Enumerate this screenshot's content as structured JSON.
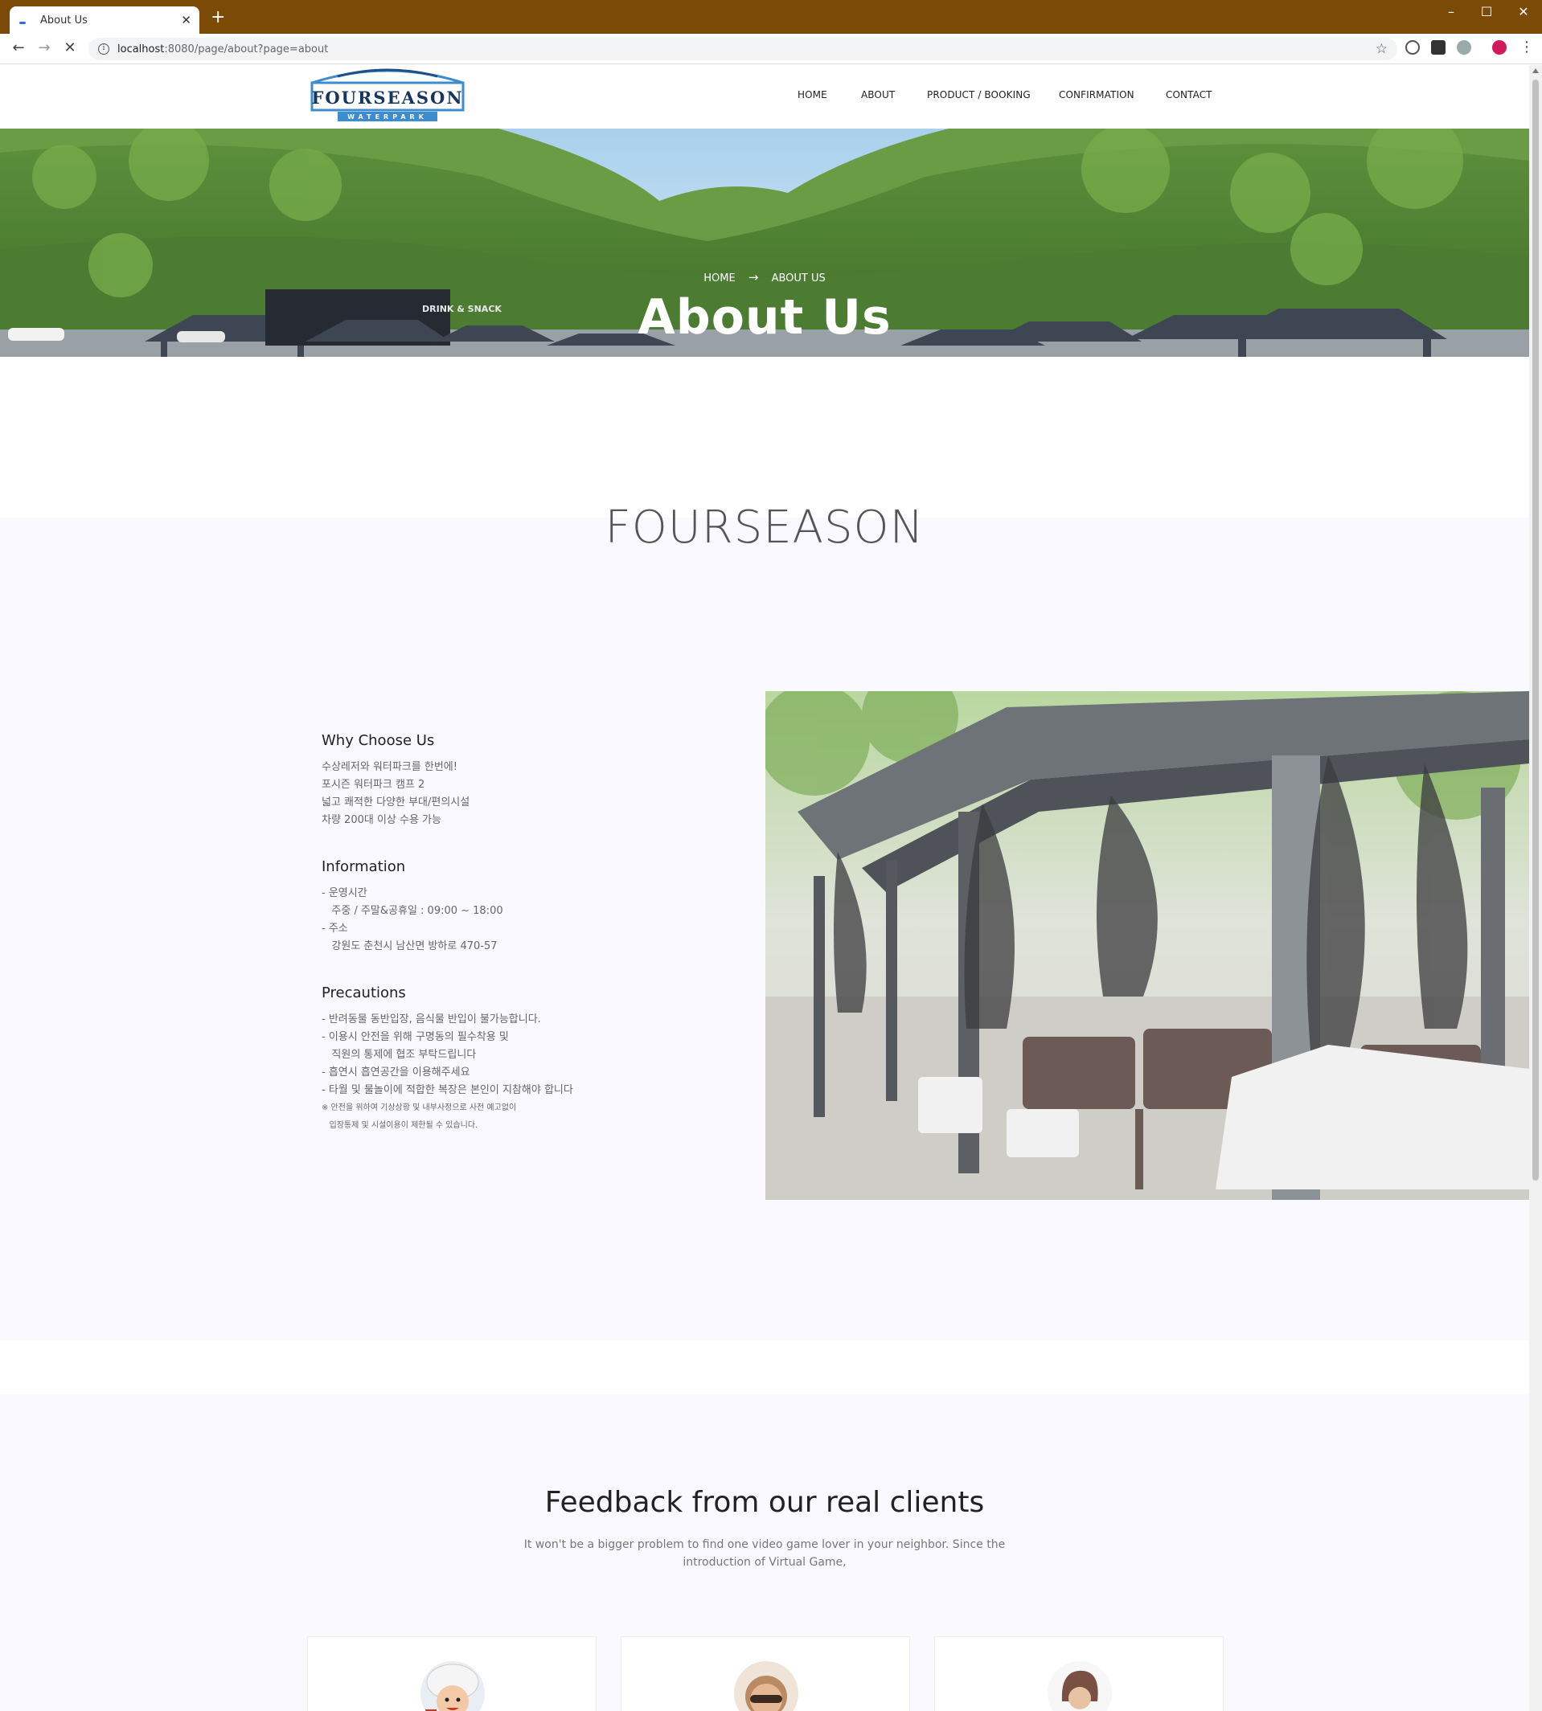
{
  "browser": {
    "tab_title": "About Us",
    "url_host": "localhost",
    "url_rest": ":8080/page/about?page=about"
  },
  "header": {
    "logo_text": "FOURSEASON",
    "logo_sub": "WATERPARK",
    "nav": [
      "HOME",
      "ABOUT",
      "PRODUCT / BOOKING",
      "CONFIRMATION",
      "CONTACT"
    ]
  },
  "hero": {
    "breadcrumb_home": "HOME",
    "breadcrumb_current": "ABOUT US",
    "sign_text": "DRINK & SNACK",
    "title": "About Us"
  },
  "brand": {
    "title": "FOURSEASON"
  },
  "info": {
    "why_heading": "Why Choose Us",
    "why_lines": [
      "수상레저와 워터파크를 한번에!",
      "포시즌 워터파크 캠프 2",
      "넓고 쾌적한 다양한 부대/편의시설",
      "차량 200대 이상 수용 가능"
    ],
    "information_heading": "Information",
    "information_lines": [
      "- 운영시간",
      "   주중 / 주말&공휴일 : 09:00 ~ 18:00",
      "- 주소",
      "   강원도 춘천시 남산면 방하로 470-57"
    ],
    "precautions_heading": "Precautions",
    "precautions_lines": [
      "- 반려동물 동반입장, 음식물 반입이 불가능합니다.",
      "- 이용시 안전을 위해 구명동의 필수착용 및",
      "   직원의 통제에 협조 부탁드립니다",
      "- 흡연시 흡연공간을 이용해주세요",
      "- 타월 및 물놀이에 적합한 복장은 본인이 지참해야 합니다"
    ],
    "precautions_notes": [
      "※ 안전을 위하여 기상상황 및 내부사정으로 사전 예고없이",
      "   입장통제 및 시설이용이 제한될 수 있습니다."
    ]
  },
  "feedback": {
    "title": "Feedback from our real clients",
    "subtitle_1": "It won't be a bigger problem to find one video game lover in your neighbor. Since the",
    "subtitle_2": "introduction of Virtual Game,"
  }
}
